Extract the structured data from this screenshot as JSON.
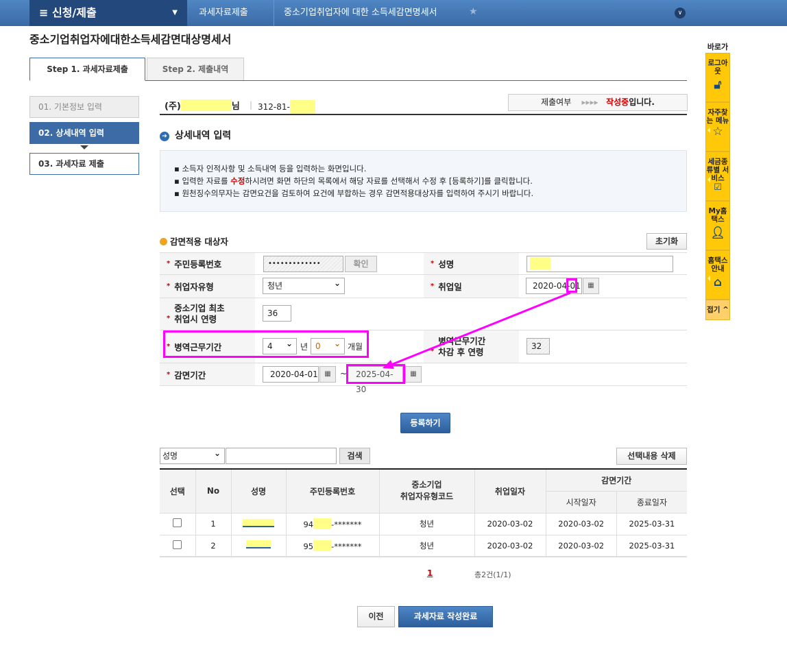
{
  "nav": {
    "menu": "≡ 신청/제출",
    "crumbs": [
      "과세자료제출",
      "중소기업취업자에 대한 소득세감면명세서"
    ]
  },
  "title": "중소기업취업자에대한소득세감면대상명세서",
  "tabs": [
    "Step 1. 과세자료제출",
    "Step 2. 제출내역"
  ],
  "steps": [
    "01. 기본정보 입력",
    "02. 상세내역 입력",
    "03. 과세자료 제출"
  ],
  "company": {
    "prefix": "(주)",
    "suffix": "님",
    "bizno": "312-81-"
  },
  "status": {
    "label": "제출여부",
    "arrows": "▸▸▸▸",
    "value": "작성중",
    "tail": "입니다."
  },
  "section1": "상세내역 입력",
  "info": {
    "line1": "소득자 인적사항 및 소득내역 등을 입력하는 화면입니다.",
    "line2a": "입력한 자료를 ",
    "line2b": "수정",
    "line2c": "하시려면 화면 하단의 목록에서 해당 자료를 선택해서 수정 후 [등록하기]를 클릭합니다.",
    "line3": "원천징수의무자는 감면요건을 검토하여 요건에 부합하는 경우 감면적용대상자를 입력하여 주시기 바랍니다."
  },
  "section2": "감면적용 대상자",
  "reset": "초기화",
  "form": {
    "rrn_label": "주민등록번호",
    "rrn_value": "•••••••••••••",
    "confirm": "확인",
    "name_label": "성명",
    "type_label": "취업자유형",
    "type_value": "청년",
    "hire_label": "취업일",
    "hire_value": "2020-04-01",
    "age_label1": "중소기업 최초",
    "age_label2": "취업시 연령",
    "age_value": "36",
    "mil_label": "병역근무기간",
    "mil_years": "4",
    "year_unit": "년",
    "mil_months": "0",
    "month_unit": "개월",
    "adj_label1": "병역근무기간",
    "adj_label2": "차감 후 연령",
    "adj_value": "32",
    "period_label": "감면기간",
    "period_start": "2020-04-01",
    "tilde": "~",
    "period_end": "2025-04-30"
  },
  "register": "등록하기",
  "search": {
    "field": "성명",
    "button": "검색",
    "delete": "선택내용 삭제"
  },
  "table": {
    "headers": [
      "선택",
      "No",
      "성명",
      "주민등록번호",
      "중소기업\n취업자유형코드",
      "취업일자",
      "감면기간",
      "시작일자",
      "종료일자"
    ],
    "rows": [
      {
        "no": "1",
        "rrn_a": "94",
        "rrn_b": "-*******",
        "type": "청년",
        "hire": "2020-03-02",
        "start": "2020-03-02",
        "end": "2025-03-31"
      },
      {
        "no": "2",
        "rrn_a": "95",
        "rrn_b": "-*******",
        "type": "청년",
        "hire": "2020-03-02",
        "start": "2020-03-02",
        "end": "2025-03-31"
      }
    ]
  },
  "paging": {
    "page": "1",
    "total": "총2건(1/1)"
  },
  "buttons": {
    "prev": "이전",
    "done": "과세자료 작성완료"
  },
  "quick": {
    "title": "바로가기",
    "items": [
      "로그아웃",
      "자주찾는 메뉴",
      "세금종류별 서비스",
      "My홈택스",
      "홈택스안내"
    ],
    "fold": "접기 ^"
  }
}
